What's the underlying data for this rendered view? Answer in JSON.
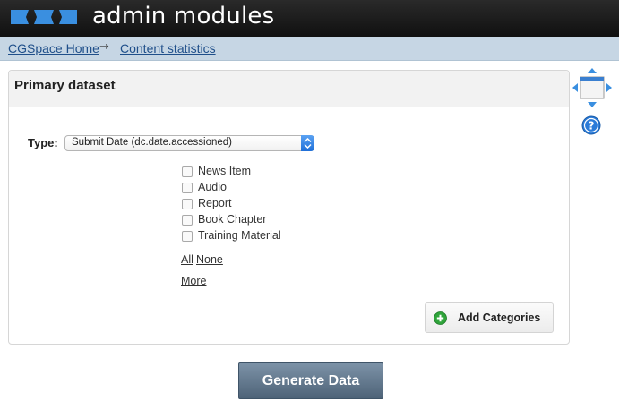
{
  "header": {
    "app_title": "admin modules",
    "logo_icon": "cgspace-logo-icon"
  },
  "breadcrumb": {
    "items": [
      {
        "label": "CGSpace Home"
      },
      {
        "label": "Content statistics"
      }
    ],
    "separator": "→"
  },
  "panel": {
    "title": "Primary dataset",
    "type_label": "Type:",
    "type_select_value": "Submit Date (dc.date.accessioned)",
    "checkboxes": [
      {
        "label": "News Item",
        "checked": false
      },
      {
        "label": "Audio",
        "checked": false
      },
      {
        "label": "Report",
        "checked": false
      },
      {
        "label": "Book Chapter",
        "checked": false
      },
      {
        "label": "Training Material",
        "checked": false
      }
    ],
    "all_link": "All",
    "none_link": "None",
    "more_link": "More",
    "add_categories_label": "Add Categories",
    "add_icon": "plus-circle-icon"
  },
  "actions": {
    "generate_label": "Generate Data"
  },
  "side_tools": {
    "layout_icon": "move-panel-icon",
    "help_icon": "help-icon"
  },
  "colors": {
    "header_bg": "#1a1a1a",
    "breadcrumb_bg": "#c6d6e4",
    "link": "#1f4f8a",
    "accent_blue": "#2b7bd8",
    "add_green": "#2fa43a",
    "generate_bg": "#5f748a"
  }
}
